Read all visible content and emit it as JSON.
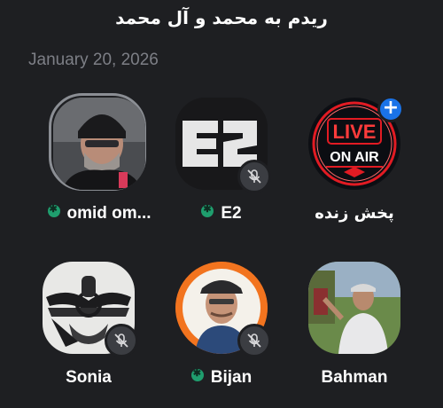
{
  "header": {
    "title": "ریدم به محمد و آل محمد",
    "date": "January 20, 2026"
  },
  "participants": [
    {
      "name": "omid om...",
      "online": true,
      "muted": false,
      "speaking": true,
      "avatar": "person-beanie-photo"
    },
    {
      "name": "E2",
      "online": true,
      "muted": true,
      "speaking": false,
      "avatar": "e2-logo"
    },
    {
      "name": "پخش زنده",
      "online": false,
      "muted": false,
      "speaking": false,
      "avatar": "live-on-air-sign",
      "badge": "+",
      "live_text": "LIVE",
      "on_air_text": "ON AIR"
    },
    {
      "name": "Sonia",
      "online": false,
      "muted": true,
      "speaking": false,
      "avatar": "faravahar-emblem"
    },
    {
      "name": "Bijan",
      "online": true,
      "muted": true,
      "speaking": false,
      "avatar": "person-cap-photo"
    },
    {
      "name": "Bahman",
      "online": false,
      "muted": false,
      "speaking": false,
      "avatar": "person-outdoor-photo"
    }
  ],
  "colors": {
    "background": "#1e1f22",
    "online": "#1f9e6e",
    "add_badge": "#1a73e8",
    "live_red": "#e21b23"
  }
}
